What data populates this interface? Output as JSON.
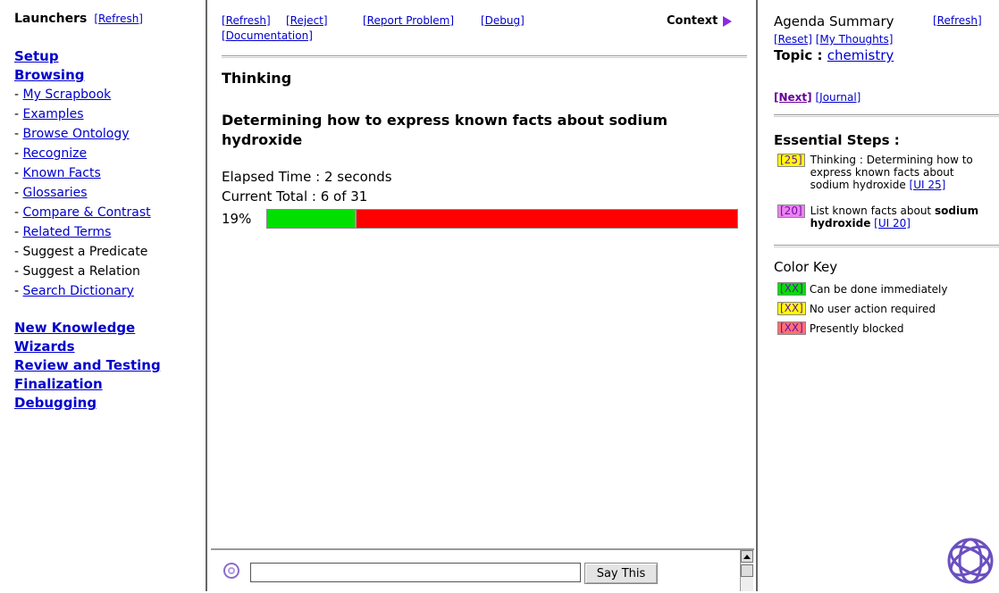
{
  "launchers": {
    "title": "Launchers",
    "refresh": "[Refresh]",
    "setup": "Setup",
    "browsing": "Browsing",
    "items": [
      "My Scrapbook",
      "Examples",
      "Browse Ontology",
      "Recognize",
      "Known Facts",
      "Glossaries",
      "Compare & Contrast",
      "Related Terms",
      "Suggest a Predicate",
      "Suggest a Relation",
      "Search Dictionary"
    ],
    "dash": "- ",
    "sections": [
      "New Knowledge",
      "Wizards",
      "Review and Testing",
      "Finalization",
      "Debugging"
    ]
  },
  "toolbar": {
    "refresh": "[Refresh]",
    "reject": "[Reject]",
    "report": "[Report Problem]",
    "debug": "[Debug]",
    "documentation": "[Documentation]",
    "context": "Context"
  },
  "main": {
    "thinking": "Thinking",
    "step_title": "Determining how to express known facts about sodium hydroxide",
    "elapsed": "Elapsed Time :  2 seconds",
    "total": "Current Total :  6 of 31",
    "percent_label": "19%",
    "progress_fraction": 0.19
  },
  "say": {
    "input_value": "",
    "button": "Say This"
  },
  "agenda": {
    "title": "Agenda Summary",
    "refresh": "[Refresh]",
    "reset": "[Reset]",
    "thoughts": "[My Thoughts]",
    "topic_label": "Topic : ",
    "topic_value": "chemistry",
    "next": "[Next]",
    "journal": "[Journal]",
    "essential_title": "Essential Steps :",
    "step1_tag": "[25]",
    "step1_text": "Thinking : Determining how to express known facts about sodium hydroxide",
    "step1_link": "[UI 25]",
    "step2_tag": "[20]",
    "step2_text": "List known facts about",
    "step2_bold": "sodium hydroxide",
    "step2_link": "[UI 20]",
    "color_key_title": "Color Key",
    "key_tag": "[XX]",
    "key_green": "Can be done immediately",
    "key_yellow": "No user action required",
    "key_red": "Presently blocked"
  },
  "colors": {
    "link": "#0000cc",
    "progress_done": "#00e000",
    "progress_remaining": "#ff0000",
    "accent": "#8a2be2"
  },
  "icons": [
    "context-arrow-icon",
    "say-icon",
    "scroll-up-icon",
    "logo-knot-icon"
  ]
}
